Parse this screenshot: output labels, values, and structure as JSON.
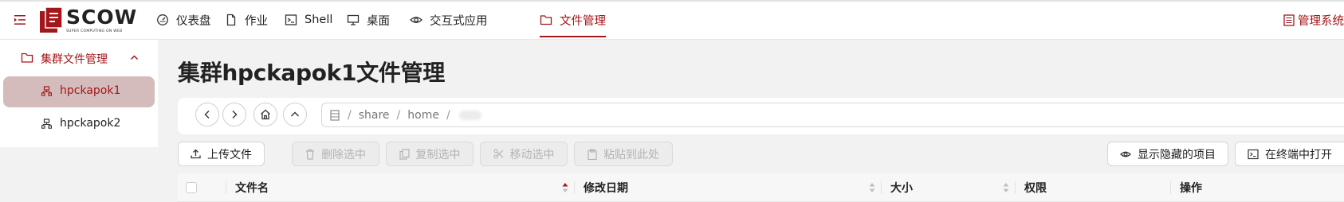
{
  "header": {
    "logo_text": "SCOW",
    "logo_subtitle": "SUPER COMPUTING ON WEB",
    "nav": [
      {
        "label": "仪表盘",
        "icon": "dashboard-icon"
      },
      {
        "label": "作业",
        "icon": "file-icon"
      },
      {
        "label": "Shell",
        "icon": "terminal-icon"
      },
      {
        "label": "桌面",
        "icon": "desktop-icon"
      },
      {
        "label": "交互式应用",
        "icon": "eye-icon"
      },
      {
        "label": "文件管理",
        "icon": "folder-icon",
        "active": true
      }
    ],
    "admin_label": "管理系统"
  },
  "sidebar": {
    "group_label": "集群文件管理",
    "items": [
      {
        "label": "hpckapok1",
        "selected": true
      },
      {
        "label": "hpckapok2",
        "selected": false
      }
    ]
  },
  "main": {
    "title": "集群hpckapok1文件管理",
    "path": {
      "segments": [
        "share",
        "home"
      ],
      "separator": "/"
    },
    "toolbar": {
      "upload": "上传文件",
      "delete": "删除选中",
      "copy": "复制选中",
      "move": "移动选中",
      "paste": "粘贴到此处",
      "show_hidden": "显示隐藏的项目",
      "open_terminal": "在终端中打开"
    },
    "table": {
      "columns": [
        "文件名",
        "修改日期",
        "大小",
        "权限",
        "操作"
      ]
    }
  },
  "colors": {
    "accent": "#a4161a",
    "selected_bg": "#d4bcbc",
    "page_bg": "#f2f2f2"
  }
}
